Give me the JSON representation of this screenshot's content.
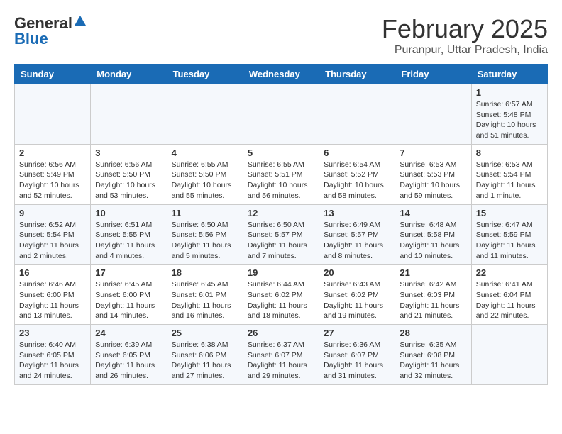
{
  "header": {
    "logo_general": "General",
    "logo_blue": "Blue",
    "month_title": "February 2025",
    "location": "Puranpur, Uttar Pradesh, India"
  },
  "days_of_week": [
    "Sunday",
    "Monday",
    "Tuesday",
    "Wednesday",
    "Thursday",
    "Friday",
    "Saturday"
  ],
  "weeks": [
    {
      "days": [
        {
          "num": "",
          "info": ""
        },
        {
          "num": "",
          "info": ""
        },
        {
          "num": "",
          "info": ""
        },
        {
          "num": "",
          "info": ""
        },
        {
          "num": "",
          "info": ""
        },
        {
          "num": "",
          "info": ""
        },
        {
          "num": "1",
          "info": "Sunrise: 6:57 AM\nSunset: 5:48 PM\nDaylight: 10 hours\nand 51 minutes."
        }
      ]
    },
    {
      "days": [
        {
          "num": "2",
          "info": "Sunrise: 6:56 AM\nSunset: 5:49 PM\nDaylight: 10 hours\nand 52 minutes."
        },
        {
          "num": "3",
          "info": "Sunrise: 6:56 AM\nSunset: 5:50 PM\nDaylight: 10 hours\nand 53 minutes."
        },
        {
          "num": "4",
          "info": "Sunrise: 6:55 AM\nSunset: 5:50 PM\nDaylight: 10 hours\nand 55 minutes."
        },
        {
          "num": "5",
          "info": "Sunrise: 6:55 AM\nSunset: 5:51 PM\nDaylight: 10 hours\nand 56 minutes."
        },
        {
          "num": "6",
          "info": "Sunrise: 6:54 AM\nSunset: 5:52 PM\nDaylight: 10 hours\nand 58 minutes."
        },
        {
          "num": "7",
          "info": "Sunrise: 6:53 AM\nSunset: 5:53 PM\nDaylight: 10 hours\nand 59 minutes."
        },
        {
          "num": "8",
          "info": "Sunrise: 6:53 AM\nSunset: 5:54 PM\nDaylight: 11 hours\nand 1 minute."
        }
      ]
    },
    {
      "days": [
        {
          "num": "9",
          "info": "Sunrise: 6:52 AM\nSunset: 5:54 PM\nDaylight: 11 hours\nand 2 minutes."
        },
        {
          "num": "10",
          "info": "Sunrise: 6:51 AM\nSunset: 5:55 PM\nDaylight: 11 hours\nand 4 minutes."
        },
        {
          "num": "11",
          "info": "Sunrise: 6:50 AM\nSunset: 5:56 PM\nDaylight: 11 hours\nand 5 minutes."
        },
        {
          "num": "12",
          "info": "Sunrise: 6:50 AM\nSunset: 5:57 PM\nDaylight: 11 hours\nand 7 minutes."
        },
        {
          "num": "13",
          "info": "Sunrise: 6:49 AM\nSunset: 5:57 PM\nDaylight: 11 hours\nand 8 minutes."
        },
        {
          "num": "14",
          "info": "Sunrise: 6:48 AM\nSunset: 5:58 PM\nDaylight: 11 hours\nand 10 minutes."
        },
        {
          "num": "15",
          "info": "Sunrise: 6:47 AM\nSunset: 5:59 PM\nDaylight: 11 hours\nand 11 minutes."
        }
      ]
    },
    {
      "days": [
        {
          "num": "16",
          "info": "Sunrise: 6:46 AM\nSunset: 6:00 PM\nDaylight: 11 hours\nand 13 minutes."
        },
        {
          "num": "17",
          "info": "Sunrise: 6:45 AM\nSunset: 6:00 PM\nDaylight: 11 hours\nand 14 minutes."
        },
        {
          "num": "18",
          "info": "Sunrise: 6:45 AM\nSunset: 6:01 PM\nDaylight: 11 hours\nand 16 minutes."
        },
        {
          "num": "19",
          "info": "Sunrise: 6:44 AM\nSunset: 6:02 PM\nDaylight: 11 hours\nand 18 minutes."
        },
        {
          "num": "20",
          "info": "Sunrise: 6:43 AM\nSunset: 6:02 PM\nDaylight: 11 hours\nand 19 minutes."
        },
        {
          "num": "21",
          "info": "Sunrise: 6:42 AM\nSunset: 6:03 PM\nDaylight: 11 hours\nand 21 minutes."
        },
        {
          "num": "22",
          "info": "Sunrise: 6:41 AM\nSunset: 6:04 PM\nDaylight: 11 hours\nand 22 minutes."
        }
      ]
    },
    {
      "days": [
        {
          "num": "23",
          "info": "Sunrise: 6:40 AM\nSunset: 6:05 PM\nDaylight: 11 hours\nand 24 minutes."
        },
        {
          "num": "24",
          "info": "Sunrise: 6:39 AM\nSunset: 6:05 PM\nDaylight: 11 hours\nand 26 minutes."
        },
        {
          "num": "25",
          "info": "Sunrise: 6:38 AM\nSunset: 6:06 PM\nDaylight: 11 hours\nand 27 minutes."
        },
        {
          "num": "26",
          "info": "Sunrise: 6:37 AM\nSunset: 6:07 PM\nDaylight: 11 hours\nand 29 minutes."
        },
        {
          "num": "27",
          "info": "Sunrise: 6:36 AM\nSunset: 6:07 PM\nDaylight: 11 hours\nand 31 minutes."
        },
        {
          "num": "28",
          "info": "Sunrise: 6:35 AM\nSunset: 6:08 PM\nDaylight: 11 hours\nand 32 minutes."
        },
        {
          "num": "",
          "info": ""
        }
      ]
    }
  ]
}
